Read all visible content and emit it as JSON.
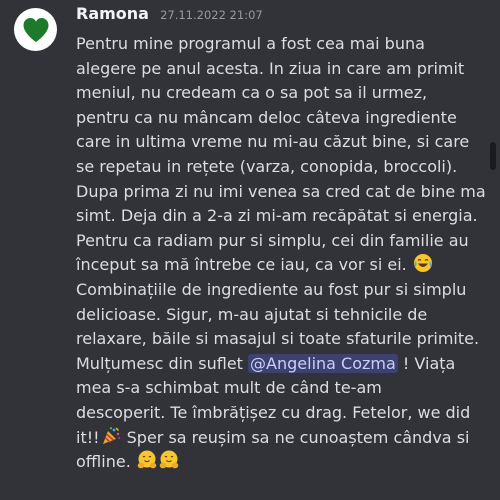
{
  "message": {
    "author": "Ramona",
    "timestamp": "27.11.2022 21:07",
    "mention": "@Angelina Cozma",
    "lines": [
      "Pentru mine programul a fost cea mai buna",
      "alegere pe anul acesta. In ziua in care am primit",
      "meniul, nu credeam ca o sa pot sa il urmez,",
      "pentru ca nu mâncam deloc câteva ingrediente",
      "care in ultima vreme nu mi-au căzut bine, si care",
      "se repetau in rețete (varza, conopida, broccoli).",
      "Dupa prima zi nu imi venea sa cred cat de bine ma",
      "simt. Deja din a 2-a zi mi-am recăpătat si energia.",
      "Pentru ca radiam pur si simplu, cei din familie au",
      "început sa mă întrebe ce iau, ca vor si ei.",
      "Combinațiile de ingrediente au fost pur si simplu",
      "delicioase. Sigur, m-au ajutat si tehnicile de",
      "relaxare, băile si masajul si toate sfaturile primite.",
      "Mulțumesc din suflet",
      "! Viața",
      "mea s-a schimbat mult de când te-am",
      "descoperit. Te îmbrățișez cu drag. Fetelor, we did",
      "it!!",
      " Sper sa reușim sa ne cunoaștem cândva si",
      "offline."
    ],
    "emojis": {
      "laugh": "face-with-tears-of-joy",
      "party": "party-popper",
      "hug": "hugging-face"
    }
  },
  "avatar": {
    "icon": "green-heart-icon",
    "background": "#ffffff",
    "heart_color": "#1e7a2b"
  },
  "colors": {
    "background": "#313338",
    "author": "#f2f3f5",
    "timestamp": "#949ba4",
    "text": "#dbdee1",
    "mention_bg": "#4a4f8c",
    "mention_text": "#c9cdfb"
  }
}
